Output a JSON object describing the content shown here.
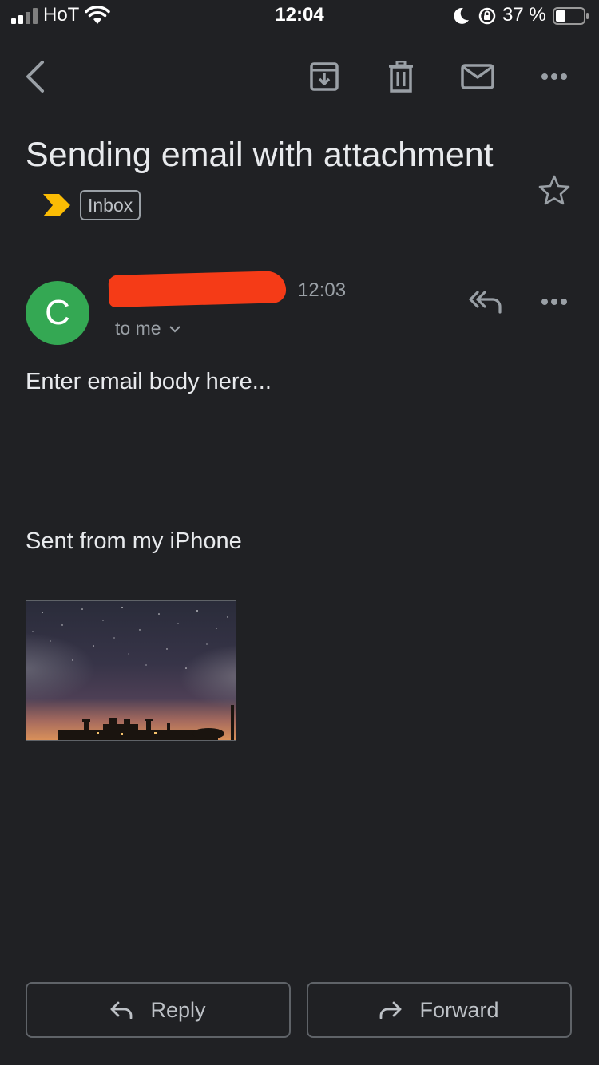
{
  "status_bar": {
    "carrier": "HoT",
    "time": "12:04",
    "battery_percent": "37 %",
    "battery_level": 0.37,
    "icons": [
      "signal-icon",
      "wifi-icon",
      "moon-icon",
      "orientation-lock-icon",
      "battery-icon"
    ]
  },
  "toolbar": {
    "icons": [
      "back-icon",
      "archive-icon",
      "trash-icon",
      "mail-icon",
      "more-icon"
    ]
  },
  "email": {
    "subject": "Sending email with attachment",
    "importance_icon": "importance-marker-icon",
    "importance_color": "#fbbc04",
    "label": "Inbox",
    "starred": false,
    "sender_initial": "C",
    "avatar_color": "#34a853",
    "time": "12:03",
    "recipient": "to me",
    "body": "Enter email body here...",
    "signature": "Sent from my iPhone",
    "attachment_icon": "image-thumbnail"
  },
  "actions": {
    "reply_label": "Reply",
    "forward_label": "Forward"
  }
}
